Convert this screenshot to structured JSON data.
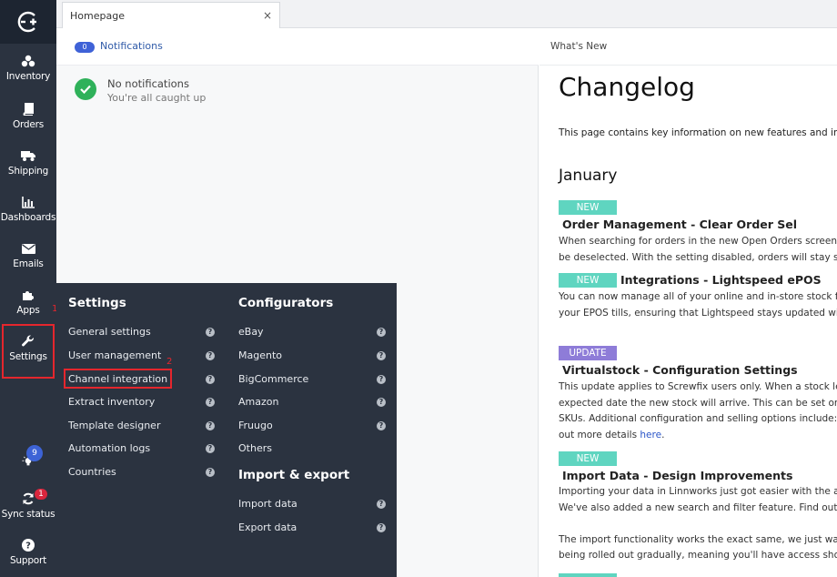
{
  "sidebar": {
    "items": [
      {
        "label": "Inventory"
      },
      {
        "label": "Orders"
      },
      {
        "label": "Shipping"
      },
      {
        "label": "Dashboards"
      },
      {
        "label": "Emails"
      },
      {
        "label": "Apps"
      },
      {
        "label": "Settings"
      },
      {
        "label": ""
      },
      {
        "label": "Sync status"
      },
      {
        "label": "Support"
      }
    ],
    "ideas_badge": "9",
    "sync_badge": "1",
    "marker_1": "1"
  },
  "tabs": [
    {
      "label": "Homepage",
      "close": "×"
    }
  ],
  "notifications": {
    "title": "Notifications",
    "count": "0",
    "empty_title": "No notifications",
    "empty_subtitle": "You're all caught up"
  },
  "whats_new": {
    "title": "What's New",
    "heading": "Changelog",
    "intro": "This page contains key information on new features and improv",
    "month": "January",
    "entries": [
      {
        "tag": "NEW",
        "title": "Order Management - Clear Order Sel",
        "lines": [
          "When searching for orders in the new Open Orders screen, you",
          "be deselected. With the setting disabled, orders will stay select"
        ]
      },
      {
        "tag": "NEW",
        "title": "Integrations - Lightspeed ePOS",
        "lines": [
          "You can now manage all of your online and in-store stock from c",
          "your EPOS tills, ensuring that Lightspeed stays updated with ac"
        ]
      },
      {
        "tag": "UPDATE",
        "title": "Virtualstock - Configuration Settings",
        "lines": [
          "This update applies to Screwfix users only. When a stock level c",
          "expected date the new stock will arrive. This can be set on the",
          "SKUs. Additional configuration and selling options include: Back"
        ],
        "last_line_prefix": "out more details ",
        "link": "here",
        "last_line_suffix": "."
      },
      {
        "tag": "NEW",
        "title": "Import Data - Design Improvements",
        "lines": [
          "Importing your data in Linnworks just got easier with the additi",
          "We've also added a new search and filter feature. Find out mor",
          "",
          "The import functionality works the exact same, we just want to",
          "being rolled out gradually, meaning you'll have access shortly if y"
        ]
      }
    ]
  },
  "settings_menu": {
    "settings_heading": "Settings",
    "settings_items": [
      "General settings",
      "User management",
      "Channel integration",
      "Extract inventory",
      "Template designer",
      "Automation logs",
      "Countries"
    ],
    "configurators_heading": "Configurators",
    "configurators_items": [
      "eBay",
      "Magento",
      "BigCommerce",
      "Amazon",
      "Fruugo",
      "Others"
    ],
    "import_export_heading": "Import & export",
    "import_export_items": [
      "Import data",
      "Export data"
    ],
    "help_glyph": "?",
    "marker_2": "2"
  }
}
